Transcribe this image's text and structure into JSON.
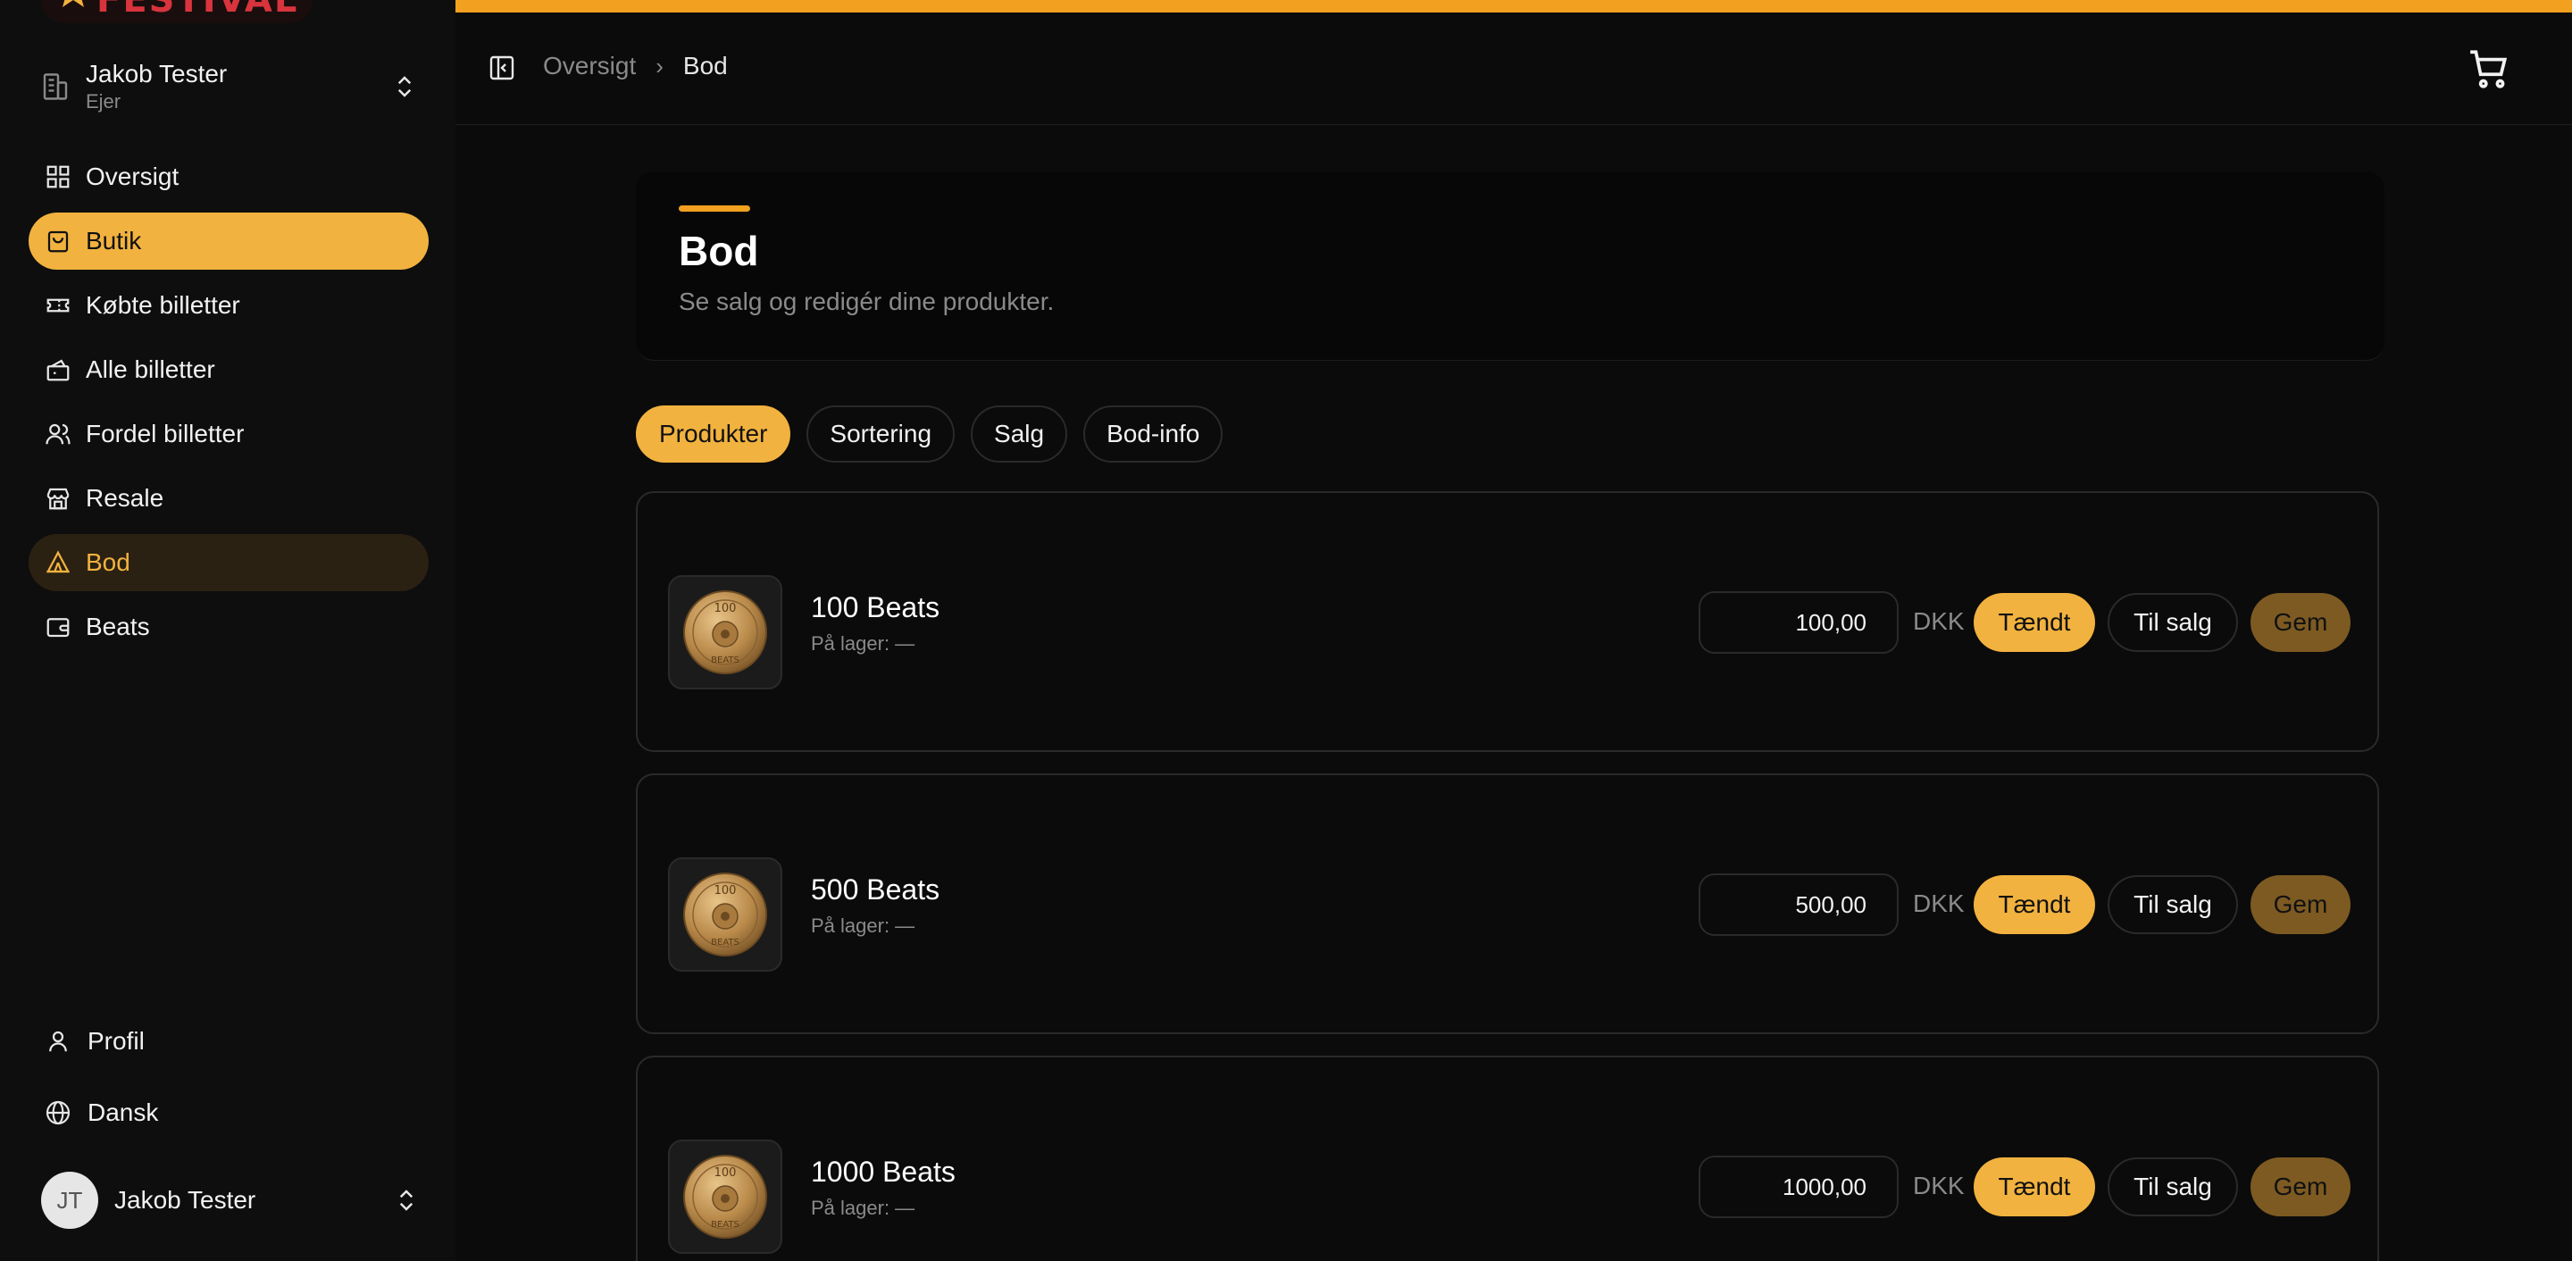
{
  "brand": {
    "logo_text": "FESTIVAL"
  },
  "org": {
    "name": "Jakob Tester",
    "role": "Ejer"
  },
  "sidebar": {
    "items": [
      {
        "label": "Oversigt",
        "icon": "grid-icon"
      },
      {
        "label": "Butik",
        "icon": "bag-icon"
      },
      {
        "label": "Købte billetter",
        "icon": "ticket-icon"
      },
      {
        "label": "Alle billetter",
        "icon": "tickets-icon"
      },
      {
        "label": "Fordel billetter",
        "icon": "users-icon"
      },
      {
        "label": "Resale",
        "icon": "store-icon"
      },
      {
        "label": "Bod",
        "icon": "tent-icon"
      },
      {
        "label": "Beats",
        "icon": "wallet-icon"
      }
    ],
    "profile_label": "Profil",
    "language_label": "Dansk"
  },
  "user": {
    "initials": "JT",
    "name": "Jakob Tester"
  },
  "breadcrumb": {
    "parent": "Oversigt",
    "separator": "›",
    "current": "Bod"
  },
  "panel": {
    "title": "Bod",
    "subtitle": "Se salg og redigér dine produkter."
  },
  "tabs": [
    {
      "label": "Produkter",
      "active": true
    },
    {
      "label": "Sortering",
      "active": false
    },
    {
      "label": "Salg",
      "active": false
    },
    {
      "label": "Bod-info",
      "active": false
    }
  ],
  "products": [
    {
      "name": "100 Beats",
      "stock": "På lager: —",
      "price": "100,00",
      "currency": "DKK",
      "on_label": "Tændt",
      "sale_label": "Til salg",
      "save_label": "Gem",
      "coin_text_top": "100",
      "coin_text_bottom": "BEATS"
    },
    {
      "name": "500 Beats",
      "stock": "På lager: —",
      "price": "500,00",
      "currency": "DKK",
      "on_label": "Tændt",
      "sale_label": "Til salg",
      "save_label": "Gem",
      "coin_text_top": "100",
      "coin_text_bottom": "BEATS"
    },
    {
      "name": "1000 Beats",
      "stock": "På lager: —",
      "price": "1000,00",
      "currency": "DKK",
      "on_label": "Tændt",
      "sale_label": "Til salg",
      "save_label": "Gem",
      "coin_text_top": "100",
      "coin_text_bottom": "BEATS"
    }
  ],
  "colors": {
    "accent": "#f2b23f",
    "accent_bar": "#f2a01f",
    "save_bg": "#7d5a22",
    "bod_active_bg": "#2a2112"
  }
}
